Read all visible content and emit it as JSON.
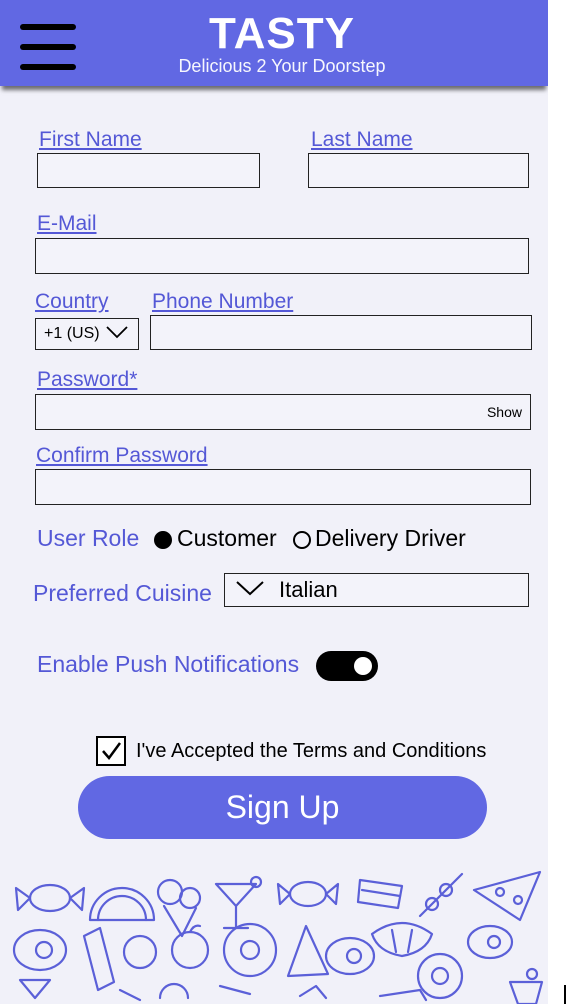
{
  "header": {
    "title": "TASTY",
    "subtitle": "Delicious 2 Your Doorstep"
  },
  "form": {
    "first_name_label": "First Name",
    "last_name_label": "Last Name",
    "email_label": "E-Mail",
    "country_label": "Country",
    "country_value": "+1 (US)",
    "phone_label": "Phone Number",
    "password_label": "Password*",
    "password_show": "Show",
    "confirm_password_label": "Confirm Password",
    "user_role_label": "User Role",
    "role_options": [
      "Customer",
      "Delivery Driver"
    ],
    "role_selected": "Customer",
    "cuisine_label": "Preferred Cuisine",
    "cuisine_value": "Italian",
    "push_label": "Enable Push Notifications",
    "push_enabled": true,
    "terms_text": "I've Accepted the Terms and Conditions",
    "terms_checked": true,
    "signup_label": "Sign Up"
  },
  "colors": {
    "accent": "#6168e3",
    "label": "#5458d6",
    "background": "#f1f1f9"
  },
  "icons": [
    "hamburger-menu-icon",
    "chevron-down-icon",
    "checkmark-icon",
    "food-pattern-illustration"
  ]
}
